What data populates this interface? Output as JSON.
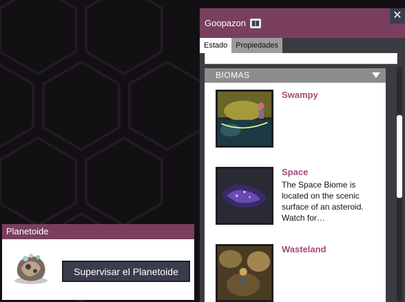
{
  "planetoid_panel": {
    "title": "Planetoide",
    "monitor_button": "Supervisar el Planetoide"
  },
  "details_panel": {
    "title": "Goopazon",
    "close_label": "✕",
    "tabs": [
      {
        "label": "Estado",
        "active": true
      },
      {
        "label": "Propiedades",
        "active": false
      }
    ],
    "biomes_section": {
      "header": "BIOMAS",
      "items": [
        {
          "name": "Swampy",
          "description": ""
        },
        {
          "name": "Space",
          "description": "The Space Biome is located on the scenic surface of an asteroid. Watch for…"
        },
        {
          "name": "Wasteland",
          "description": ""
        }
      ]
    }
  },
  "colors": {
    "header_purple": "#7a3f5e",
    "biome_name": "#a64a7d",
    "button_dark": "#3a3d4d"
  }
}
